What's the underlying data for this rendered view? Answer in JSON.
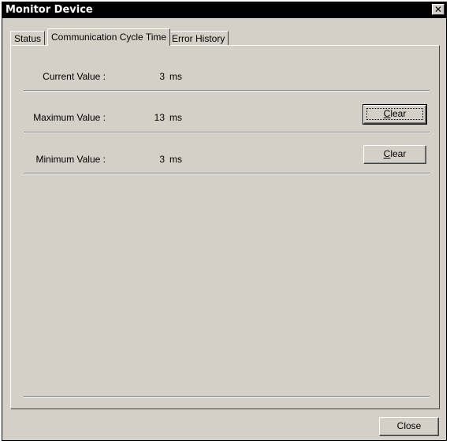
{
  "window": {
    "title": "Monitor Device",
    "close_glyph": "✕"
  },
  "tabs": [
    {
      "label": "Status"
    },
    {
      "label": "Communication Cycle Time"
    },
    {
      "label": "Error History"
    }
  ],
  "active_tab": "Communication Cycle Time",
  "rows": [
    {
      "label": "Current Value :",
      "value": "3",
      "unit": "ms"
    },
    {
      "label": "Maximum Value :",
      "value": "13",
      "unit": "ms",
      "button": {
        "mnemonic": "C",
        "rest": "lear"
      }
    },
    {
      "label": "Minimum Value :",
      "value": "3",
      "unit": "ms",
      "button": {
        "mnemonic": "C",
        "rest": "lear"
      }
    }
  ],
  "footer": {
    "close_label": "Close"
  }
}
